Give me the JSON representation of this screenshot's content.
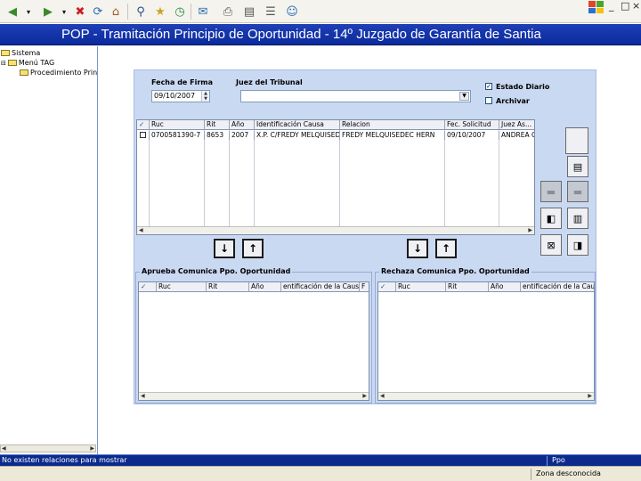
{
  "window": {
    "title": "POP - Tramitación Principio de Oportunidad - 14º Juzgado de Garantía de Santia",
    "controls": {
      "minimize": "_",
      "maximize": "□",
      "close": "×"
    }
  },
  "tree": {
    "nodes": [
      "Sistema",
      "Menú TAG",
      "Procedimiento Princip"
    ]
  },
  "form": {
    "fecha_label": "Fecha de Firma",
    "fecha_value": "09/10/2007",
    "juez_label": "Juez del Tribunal",
    "juez_value": "",
    "estado_diario_label": "Estado Diario",
    "estado_diario_checked": true,
    "archivar_label": "Archivar",
    "archivar_checked": false
  },
  "main_grid": {
    "columns": [
      "Ruc",
      "Rit",
      "Año",
      "Identificación Causa",
      "Relacion",
      "Fec. Solicitud",
      "Juez As..."
    ],
    "rows": [
      [
        "0700581390-7",
        "8653",
        "2007",
        "X.P. C/FREDY MELQUISEDE",
        "FREDY MELQUISEDEC HERN",
        "09/10/2007",
        "ANDREA C"
      ]
    ]
  },
  "aprueba": {
    "title": "Aprueba Comunica Ppo. Oportunidad",
    "columns": [
      "Ruc",
      "Rit",
      "Año",
      "entificación de la Causa",
      "F"
    ]
  },
  "rechaza": {
    "title": "Rechaza Comunica Ppo. Oportunidad",
    "columns": [
      "Ruc",
      "Rit",
      "Año",
      "entificación de la Causa"
    ]
  },
  "buttons": {
    "down": "↓",
    "up": "↑"
  },
  "status": {
    "message": "No existen relaciones para mostrar",
    "right": "Ppo",
    "zone": "Zona desconocida"
  }
}
